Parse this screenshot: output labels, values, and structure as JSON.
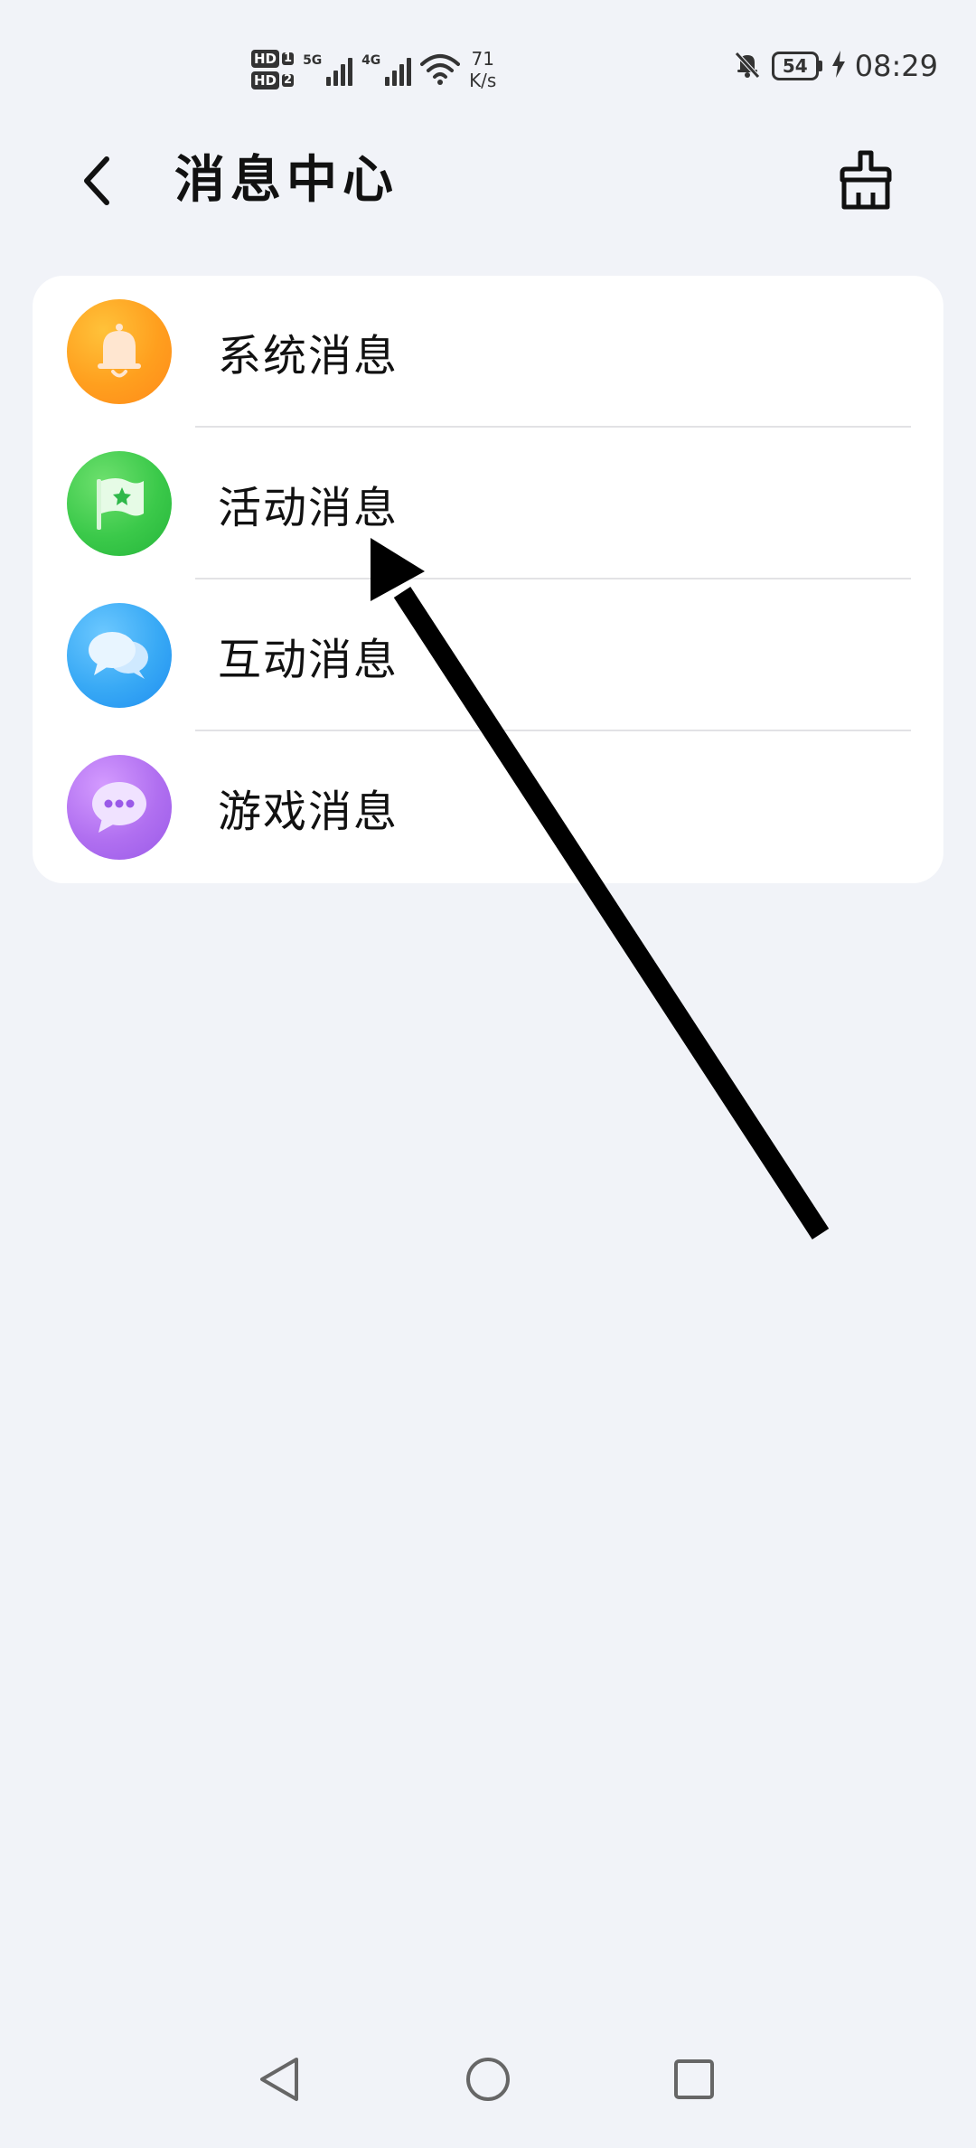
{
  "status_bar": {
    "sim1": "HD",
    "sim1_num": "1",
    "sim2": "HD",
    "sim2_num": "2",
    "net1": "5G",
    "net2": "4G",
    "speed_value": "71",
    "speed_unit": "K/s",
    "battery": "54",
    "time": "08:29",
    "icons": [
      "mute-bell-icon",
      "wifi-icon",
      "charging-icon"
    ]
  },
  "header": {
    "title": "消息中心",
    "back_icon": "chevron-left-icon",
    "clean_icon": "broom-icon"
  },
  "list": {
    "items": [
      {
        "label": "系统消息",
        "icon": "bell-icon",
        "color": "#ff9f1e"
      },
      {
        "label": "活动消息",
        "icon": "flag-icon",
        "color": "#3bc94a"
      },
      {
        "label": "互动消息",
        "icon": "chat-bubbles-icon",
        "color": "#38a9f5"
      },
      {
        "label": "游戏消息",
        "icon": "message-dots-icon",
        "color": "#b06ff0"
      }
    ]
  },
  "nav": {
    "icons": [
      "back-triangle-icon",
      "home-circle-icon",
      "recents-square-icon"
    ]
  }
}
